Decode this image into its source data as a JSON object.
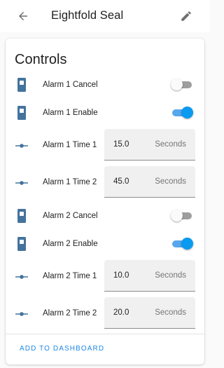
{
  "header": {
    "title": "Eightfold Seal",
    "back_icon": "arrow-left-icon",
    "edit_icon": "pencil-icon"
  },
  "card": {
    "title": "Controls",
    "rows": [
      {
        "type": "switch",
        "label": "Alarm 1 Cancel",
        "icon": "door-switch-icon",
        "state": "off"
      },
      {
        "type": "switch",
        "label": "Alarm 1 Enable",
        "icon": "door-switch-icon",
        "state": "on"
      },
      {
        "type": "number",
        "label": "Alarm 1 Time 1",
        "icon": "slider-icon",
        "value": "15.0",
        "unit": "Seconds"
      },
      {
        "type": "number",
        "label": "Alarm 1 Time 2",
        "icon": "slider-icon",
        "value": "45.0",
        "unit": "Seconds"
      },
      {
        "type": "switch",
        "label": "Alarm 2 Cancel",
        "icon": "door-switch-icon",
        "state": "off"
      },
      {
        "type": "switch",
        "label": "Alarm 2 Enable",
        "icon": "door-switch-icon",
        "state": "on"
      },
      {
        "type": "number",
        "label": "Alarm 2 Time 1",
        "icon": "slider-icon",
        "value": "10.0",
        "unit": "Seconds"
      },
      {
        "type": "number",
        "label": "Alarm 2 Time 2",
        "icon": "slider-icon",
        "value": "20.0",
        "unit": "Seconds"
      }
    ],
    "footer_button": "ADD TO DASHBOARD"
  },
  "colors": {
    "accent": "#0a9af0",
    "icon": "#44739e",
    "link": "#1e88e5"
  }
}
